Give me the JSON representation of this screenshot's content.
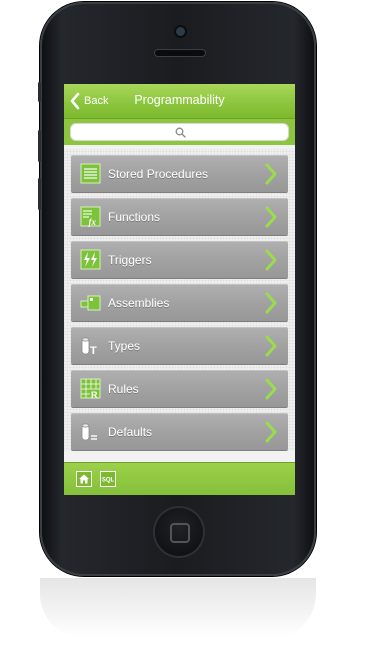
{
  "nav": {
    "back_label": "Back",
    "title": "Programmability"
  },
  "search": {
    "icon": "search-icon"
  },
  "items": [
    {
      "label": "Stored Procedures",
      "icon": "stored-procedures-icon"
    },
    {
      "label": "Functions",
      "icon": "functions-icon"
    },
    {
      "label": "Triggers",
      "icon": "triggers-icon"
    },
    {
      "label": "Assemblies",
      "icon": "assemblies-icon"
    },
    {
      "label": "Types",
      "icon": "types-icon"
    },
    {
      "label": "Rules",
      "icon": "rules-icon"
    },
    {
      "label": "Defaults",
      "icon": "defaults-icon"
    }
  ],
  "tabbar": {
    "home_icon": "home-icon",
    "sql_label": "SQL"
  },
  "colors": {
    "accent_green": "#8cc63f",
    "item_gray": "#a2a2a2",
    "text_white": "#ffffff"
  }
}
